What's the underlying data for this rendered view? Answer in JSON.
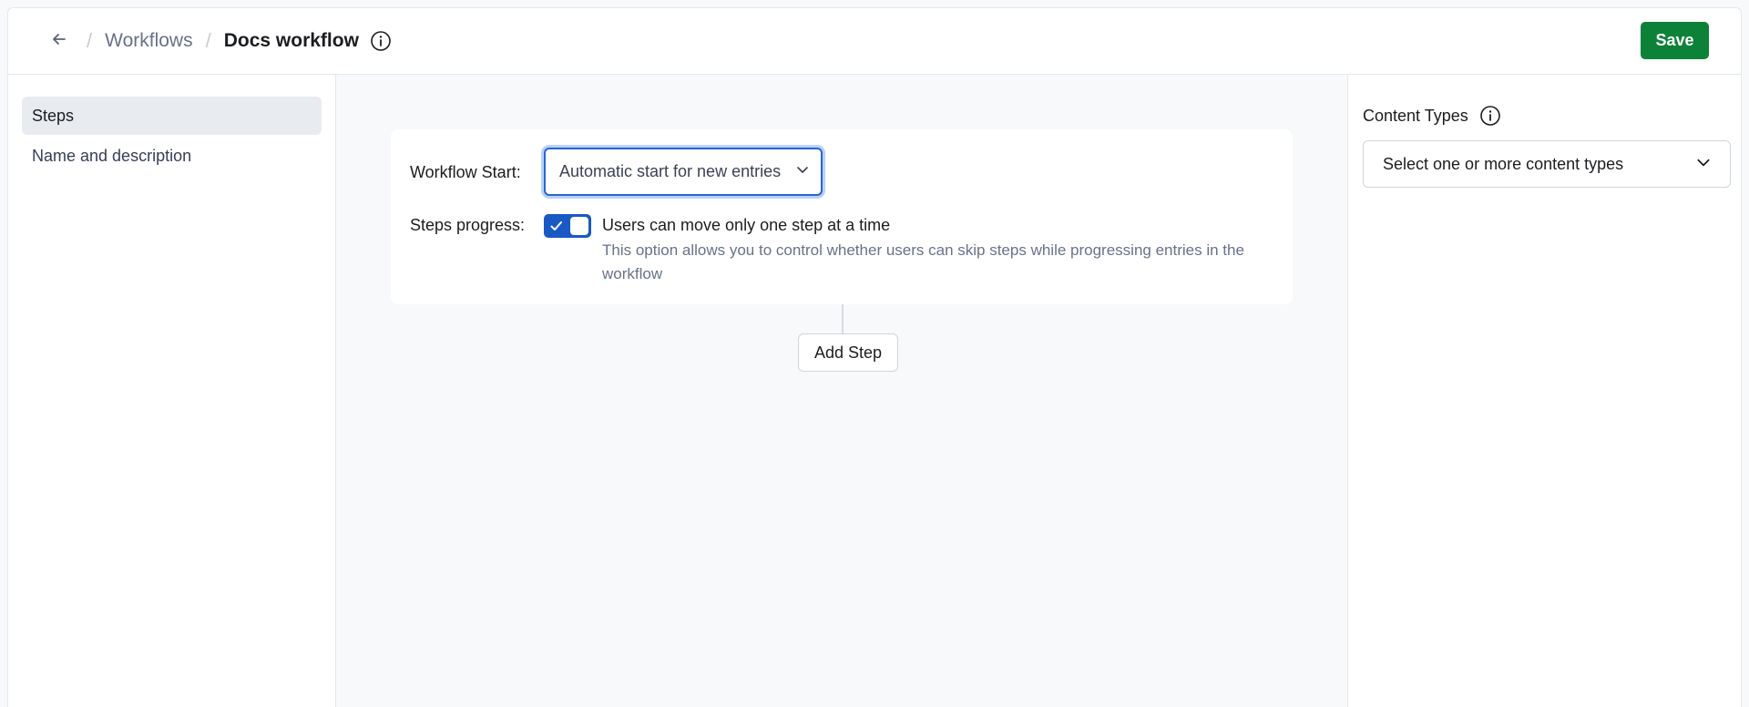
{
  "header": {
    "breadcrumb_parent": "Workflows",
    "breadcrumb_current": "Docs workflow",
    "save_label": "Save",
    "save_color": "#0d8137"
  },
  "sidebar": {
    "items": [
      {
        "label": "Steps",
        "active": true
      },
      {
        "label": "Name and description",
        "active": false
      }
    ]
  },
  "main": {
    "workflow_start_label": "Workflow Start:",
    "workflow_start_value": "Automatic start for new entries",
    "steps_progress_label": "Steps progress:",
    "steps_progress_toggle_on": true,
    "steps_progress_option": "Users can move only one step at a time",
    "steps_progress_description": "This option allows you to control whether users can skip steps while progressing entries in the workflow",
    "add_step_label": "Add Step",
    "accent_color": "#1a58c4"
  },
  "right_panel": {
    "content_types_label": "Content Types",
    "content_types_placeholder": "Select one or more content types"
  },
  "icons": [
    "arrow-left-icon",
    "info-icon",
    "chevron-down-icon",
    "check-icon"
  ]
}
